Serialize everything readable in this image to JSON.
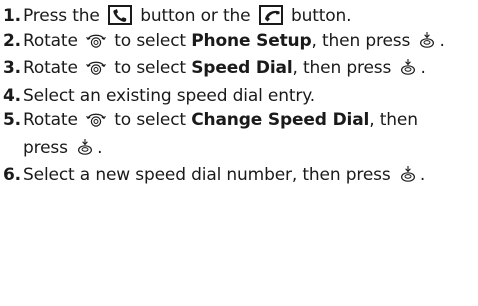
{
  "steps": [
    {
      "num": "1.",
      "parts": {
        "a": "Press the",
        "b": "button or the",
        "c": "button."
      },
      "icons": [
        "phone-pickup-button-icon",
        "phone-hangup-button-icon"
      ]
    },
    {
      "num": "2.",
      "parts": {
        "a": "Rotate",
        "b": "to select",
        "bold": "Phone Setup",
        "c": ", then press",
        "d": "."
      },
      "icons": [
        "selector-knob-rotate-icon",
        "selector-knob-press-icon"
      ]
    },
    {
      "num": "3.",
      "parts": {
        "a": "Rotate",
        "b": "to select",
        "bold": "Speed Dial",
        "c": ", then press",
        "d": "."
      },
      "icons": [
        "selector-knob-rotate-icon",
        "selector-knob-press-icon"
      ]
    },
    {
      "num": "4.",
      "parts": {
        "a": "Select an existing speed dial entry."
      }
    },
    {
      "num": "5.",
      "parts": {
        "a": "Rotate",
        "b": "to select",
        "bold": "Change Speed Dial",
        "c": ", then press",
        "d": "."
      },
      "icons": [
        "selector-knob-rotate-icon",
        "selector-knob-press-icon"
      ]
    },
    {
      "num": "6.",
      "parts": {
        "a": "Select a new speed dial number, then press",
        "d": "."
      },
      "icons": [
        "selector-knob-press-icon"
      ]
    }
  ]
}
